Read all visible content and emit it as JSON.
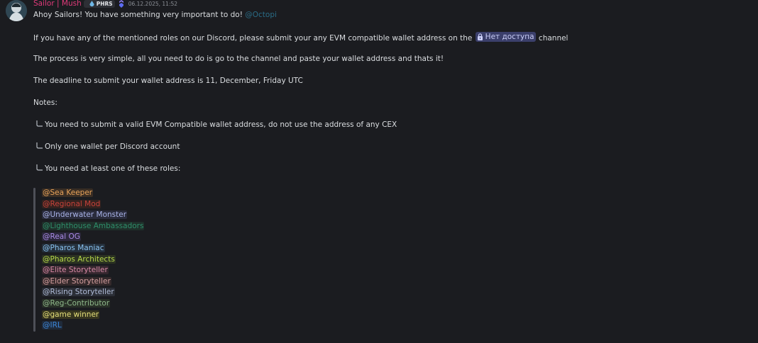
{
  "message": {
    "author": "Sailor | Mush",
    "tag": "PHRS",
    "timestamp": "06.12.2025, 11:52",
    "line1_text": "Ahoy Sailors! You have something very important to do!",
    "line1_mention": "@Octopi",
    "line2_before": "If you have any of the mentioned roles on our Discord, please submit your any EVM compatible wallet address on the",
    "line2_channel": "Нет доступа",
    "line2_after": "channel",
    "line3": "The process is very simple, all you need to do is go to the channel and paste your wallet address and thats it!",
    "line4": "The deadline to submit your wallet address is 11, December, Friday UTC",
    "line5": "Notes:",
    "note1": "You need to submit a valid EVM Compatible wallet address, do not use the address of any CEX",
    "note2": "Only one wallet per Discord account",
    "note3": "You need at least one of these roles:",
    "roles": [
      {
        "name": "@Sea Keeper",
        "color": "#e8a35a",
        "bg": "#3a2e24"
      },
      {
        "name": "@Regional Mod",
        "color": "#c8423a",
        "bg": "#34221f"
      },
      {
        "name": "@Underwater Monster",
        "color": "#a9b3e8",
        "bg": "#2a2c3c"
      },
      {
        "name": "@Lighthouse Ambassadors",
        "color": "#2e8f6a",
        "bg": "#1f2f2a"
      },
      {
        "name": "@Real OG",
        "color": "#a98ae6",
        "bg": "#2c283c"
      },
      {
        "name": "@Pharos Maniac",
        "color": "#8ac3f0",
        "bg": "#25303c"
      },
      {
        "name": "@Pharos Architects",
        "color": "#b7d94a",
        "bg": "#2c3322"
      },
      {
        "name": "@Elite Storyteller",
        "color": "#d88aa6",
        "bg": "#35272e"
      },
      {
        "name": "@Elder Storyteller",
        "color": "#d6a0a0",
        "bg": "#34292b"
      },
      {
        "name": "@Rising Storyteller",
        "color": "#b0bcd8",
        "bg": "#2b2e36"
      },
      {
        "name": "@Reg-Contributor",
        "color": "#8fb88a",
        "bg": "#283027"
      },
      {
        "name": "@game winner",
        "color": "#e6e07a",
        "bg": "#36351f"
      },
      {
        "name": "@IRL",
        "color": "#3c86d8",
        "bg": "#1f2a3a"
      }
    ]
  }
}
